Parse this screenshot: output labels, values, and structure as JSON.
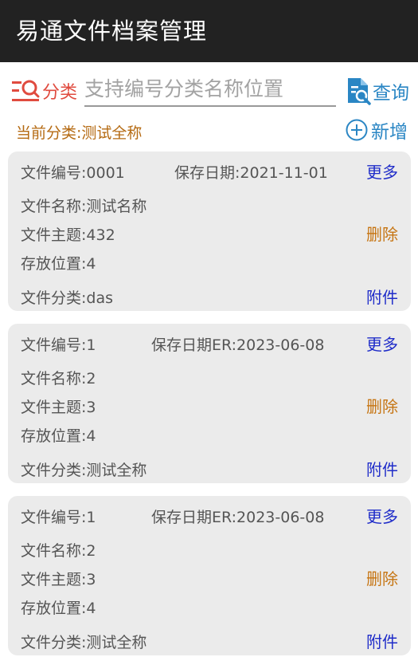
{
  "app": {
    "title": "易通文件档案管理"
  },
  "search": {
    "category_label": "分类",
    "placeholder": "支持编号分类名称位置",
    "query_label": "查询"
  },
  "current_category": "当前分类:测试全称",
  "add_label": "新增",
  "records": [
    {
      "number": "文件编号:0001",
      "date": "保存日期:2021-11-01",
      "name": "文件名称:测试名称",
      "subject": "文件主题:432",
      "location": "存放位置:4",
      "category": "文件分类:das",
      "more_label": "更多",
      "delete_label": "删除",
      "attach_label": "附件"
    },
    {
      "number": "文件编号:1",
      "date": "保存日期ER:2023-06-08",
      "name": "文件名称:2",
      "subject": "文件主题:3",
      "location": "存放位置:4",
      "category": "文件分类:测试全称",
      "more_label": "更多",
      "delete_label": "删除",
      "attach_label": "附件"
    },
    {
      "number": "文件编号:1",
      "date": "保存日期ER:2023-06-08",
      "name": "文件名称:2",
      "subject": "文件主题:3",
      "location": "存放位置:4",
      "category": "文件分类:测试全称",
      "more_label": "更多",
      "delete_label": "删除",
      "attach_label": "附件"
    }
  ],
  "colors": {
    "titlebar": "#222222",
    "accent_blue": "#2a86c4",
    "link_blue": "#1f2cc9",
    "delete_orange": "#c67411",
    "category_red": "#e04b3f",
    "card_bg": "#ebebeb"
  },
  "icons": {
    "category": "category-search-icon",
    "query": "document-search-icon",
    "add": "plus-circle-icon"
  }
}
